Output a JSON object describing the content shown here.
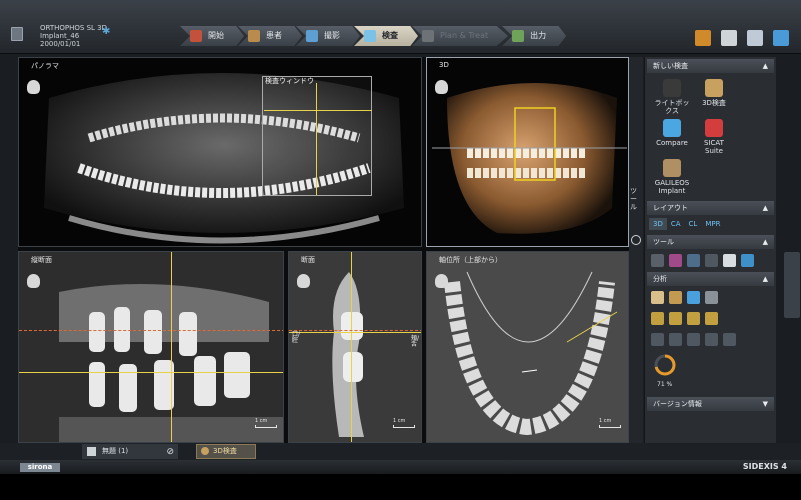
{
  "device": {
    "line1": "ORTHOPHOS SL 3D",
    "line2": "Implant_46",
    "line3": "2000/01/01"
  },
  "tabs": [
    {
      "label": "開始",
      "state": "normal",
      "color": "#c4513b"
    },
    {
      "label": "患者",
      "state": "normal",
      "color": "#b98b4c"
    },
    {
      "label": "撮影",
      "state": "normal",
      "color": "#5d9fd2"
    },
    {
      "label": "検査",
      "state": "active",
      "color": "#7cc1e6"
    },
    {
      "label": "Plan & Treat",
      "state": "disabled",
      "color": "#6d7276"
    },
    {
      "label": "出力",
      "state": "normal",
      "color": "#6fa35a"
    }
  ],
  "system_icons": [
    {
      "name": "book-icon",
      "color": "#d18a2a"
    },
    {
      "name": "settings-icon",
      "color": "#cfd4d9"
    },
    {
      "name": "display-icon",
      "color": "#bfcad6"
    },
    {
      "name": "exit-icon",
      "color": "#4a9ad8"
    }
  ],
  "panes": {
    "panorama": {
      "label": "パノラマ",
      "window_label": "検査ウィンドウ"
    },
    "three_d": {
      "label": "3D"
    },
    "longitudinal": {
      "label": "縦断面",
      "scale": "1 cm"
    },
    "cross": {
      "label": "断面",
      "scale": "1 cm",
      "side_left": "口/腔",
      "side_right": "頬/舌"
    },
    "axial": {
      "label": "軸位所（上部から）",
      "scale": "1 cm"
    }
  },
  "side_strip_label": "ツール",
  "right_panel": {
    "new_exam": {
      "title": "新しい検査",
      "tools": [
        {
          "label": "ライトボックス",
          "color": "#3a3a3a"
        },
        {
          "label": "3D検査",
          "color": "#c8a060"
        },
        {
          "label": "Compare",
          "color": "#4aa7e2"
        },
        {
          "label": "SICAT Suite",
          "color": "#d33d3d"
        },
        {
          "label": "GALILEOS Implant",
          "color": "#b08f64"
        }
      ]
    },
    "layout": {
      "title": "レイアウト",
      "buttons": [
        "3D",
        "CA",
        "CL",
        "MPR"
      ]
    },
    "tools": {
      "title": "ツール"
    },
    "analysis": {
      "title": "分析",
      "percent": "71 %",
      "progress": 0.71
    },
    "version": {
      "title": "バージョン情報"
    }
  },
  "bottom": {
    "status": "無題 (1)",
    "active_tab": "3D検査"
  },
  "footer": {
    "logo": "sirona",
    "brand": "SIDEXIS 4"
  }
}
